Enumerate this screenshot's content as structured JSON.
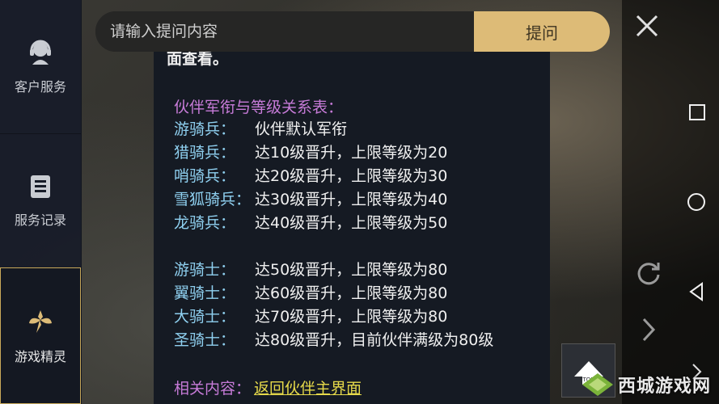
{
  "sidebar": {
    "items": [
      {
        "label": "客户服务",
        "icon": "customer-service-icon"
      },
      {
        "label": "服务记录",
        "icon": "service-record-icon"
      },
      {
        "label": "游戏精灵",
        "icon": "game-sprite-icon",
        "active": true
      }
    ]
  },
  "search": {
    "placeholder": "请输入提问内容",
    "button_label": "提问"
  },
  "content": {
    "cut_text": "面查看。",
    "section_title": "伙伴军衔与等级关系表：",
    "rows_group1": [
      {
        "rank": "游骑兵：",
        "desc": "伙伴默认军衔"
      },
      {
        "rank": "猎骑兵：",
        "desc": "达10级晋升，上限等级为20"
      },
      {
        "rank": "哨骑兵：",
        "desc": "达20级晋升，上限等级为30"
      },
      {
        "rank": "雪狐骑兵：",
        "desc": "达30级晋升，上限等级为40"
      },
      {
        "rank": "龙骑兵：",
        "desc": "达40级晋升，上限等级为50"
      }
    ],
    "rows_group2": [
      {
        "rank": "游骑士：",
        "desc": "达50级晋升，上限等级为80"
      },
      {
        "rank": "翼骑士：",
        "desc": "达60级晋升，上限等级为80"
      },
      {
        "rank": "大骑士：",
        "desc": "达70级晋升，上限等级为80"
      },
      {
        "rank": "圣骑士：",
        "desc": "达80级晋升，目前伙伴满级为80级"
      }
    ],
    "related_label": "相关内容：",
    "related_link": "返回伙伴主界面"
  },
  "top_button": {
    "label": "TOP"
  },
  "watermark": {
    "text": "西城游戏网"
  },
  "colors": {
    "accent": "#ddbb77",
    "rank": "#8fd0f0",
    "heading": "#c77bd8",
    "link": "#e6d94a"
  }
}
